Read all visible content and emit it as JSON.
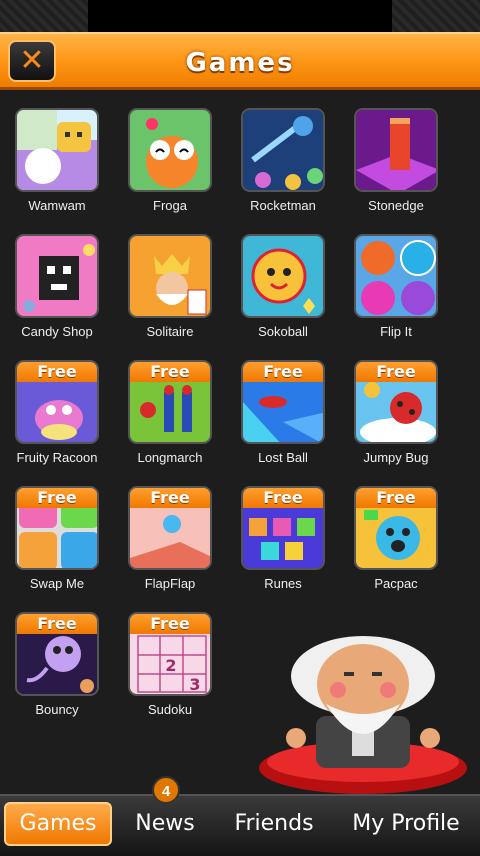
{
  "header": {
    "title": "Games",
    "close_icon": "close-x-icon"
  },
  "games": [
    {
      "name": "Wamwam",
      "free": false
    },
    {
      "name": "Froga",
      "free": false
    },
    {
      "name": "Rocketman",
      "free": false
    },
    {
      "name": "Stonedge",
      "free": false
    },
    {
      "name": "Candy Shop",
      "free": false
    },
    {
      "name": "Solitaire",
      "free": false
    },
    {
      "name": "Sokoball",
      "free": false
    },
    {
      "name": "Flip It",
      "free": false
    },
    {
      "name": "Fruity Racoon",
      "free": true
    },
    {
      "name": "Longmarch",
      "free": true
    },
    {
      "name": "Lost Ball",
      "free": true
    },
    {
      "name": "Jumpy Bug",
      "free": true
    },
    {
      "name": "Swap Me",
      "free": true
    },
    {
      "name": "FlapFlap",
      "free": true
    },
    {
      "name": "Runes",
      "free": true
    },
    {
      "name": "Pacpac",
      "free": true
    },
    {
      "name": "Bouncy",
      "free": true
    },
    {
      "name": "Sudoku",
      "free": true
    }
  ],
  "free_label": "Free",
  "nav": {
    "tabs": [
      "Games",
      "News",
      "Friends",
      "My Profile"
    ],
    "active": "Games",
    "news_badge": "4"
  },
  "colors": {
    "accent": "#f07800",
    "background": "#1d1d1d"
  }
}
